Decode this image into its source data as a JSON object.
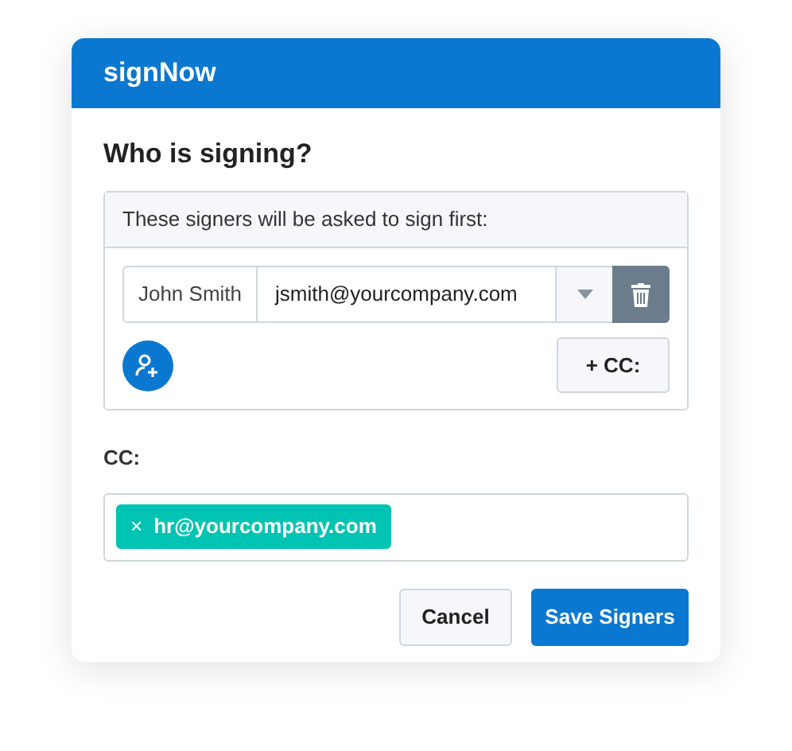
{
  "header": {
    "logo": "signNow"
  },
  "title": "Who is signing?",
  "signers_panel": {
    "heading": "These signers will be asked to sign first:",
    "signers": [
      {
        "name": "John Smith",
        "email": "jsmith@yourcompany.com"
      }
    ],
    "cc_button": "+ CC:"
  },
  "cc": {
    "label": "CC:",
    "tags": [
      {
        "remove": "×",
        "email": "hr@yourcompany.com"
      }
    ]
  },
  "buttons": {
    "cancel": "Cancel",
    "save": "Save Signers"
  }
}
